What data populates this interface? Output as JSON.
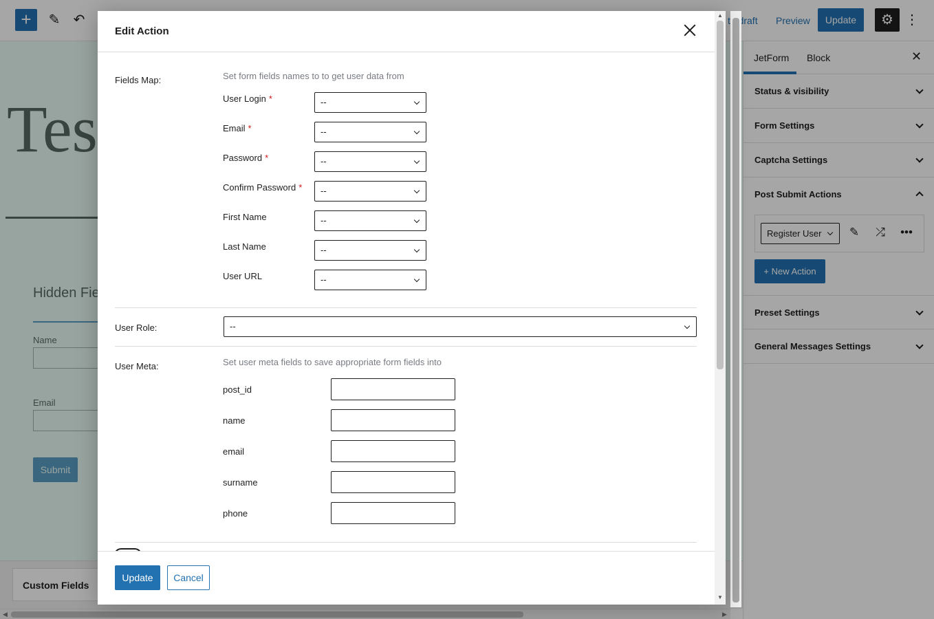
{
  "topbar": {
    "add_icon": "plus-icon",
    "tool_icon": "pencil-icon",
    "undo_icon": "undo-icon",
    "switch_draft_label": "to draft",
    "preview_label": "Preview",
    "update_label": "Update",
    "settings_icon": "gear-icon",
    "more_icon": "vertical-ellipsis-icon"
  },
  "canvas": {
    "title": "Test",
    "section_heading": "Hidden Fie",
    "name_label": "Name",
    "email_label": "Email",
    "submit_label": "Submit"
  },
  "bottom_panel": {
    "tab_label": "Custom Fields"
  },
  "sidebar": {
    "tabs": [
      {
        "label": "JetForm",
        "active": true
      },
      {
        "label": "Block",
        "active": false
      }
    ],
    "close_icon": "close-icon",
    "panels": [
      {
        "title": "Status & visibility",
        "expanded": false
      },
      {
        "title": "Form Settings",
        "expanded": false
      },
      {
        "title": "Captcha Settings",
        "expanded": false
      },
      {
        "title": "Post Submit Actions",
        "expanded": true
      },
      {
        "title": "Preset Settings",
        "expanded": false
      },
      {
        "title": "General Messages Settings",
        "expanded": false
      }
    ],
    "post_submit_actions": {
      "selected_action": "Register User",
      "edit_icon": "pencil-icon",
      "conditions_icon": "shuffle-icon",
      "more_icon": "horizontal-ellipsis-icon",
      "new_action_label": "+ New Action"
    }
  },
  "modal": {
    "title": "Edit Action",
    "close_icon": "close-icon",
    "fields_map": {
      "label": "Fields Map:",
      "help": "Set form fields names to to get user data from",
      "fields": [
        {
          "label": "User Login",
          "required": true,
          "value": "--"
        },
        {
          "label": "Email",
          "required": true,
          "value": "--"
        },
        {
          "label": "Password",
          "required": true,
          "value": "--"
        },
        {
          "label": "Confirm Password",
          "required": true,
          "value": "--"
        },
        {
          "label": "First Name",
          "required": false,
          "value": "--"
        },
        {
          "label": "Last Name",
          "required": false,
          "value": "--"
        },
        {
          "label": "User URL",
          "required": false,
          "value": "--"
        }
      ],
      "required_mark": "*"
    },
    "user_role": {
      "label": "User Role:",
      "value": "--"
    },
    "user_meta": {
      "label": "User Meta:",
      "help": "Set user meta fields to save appropriate form fields into",
      "fields": [
        {
          "label": "post_id",
          "value": ""
        },
        {
          "label": "name",
          "value": ""
        },
        {
          "label": "email",
          "value": ""
        },
        {
          "label": "surname",
          "value": ""
        },
        {
          "label": "phone",
          "value": ""
        }
      ]
    },
    "footer": {
      "update_label": "Update",
      "cancel_label": "Cancel"
    }
  },
  "colors": {
    "accent": "#2271b1",
    "required": "#cc1818",
    "help_text": "#787c82",
    "dark": "#1e1e1e"
  }
}
